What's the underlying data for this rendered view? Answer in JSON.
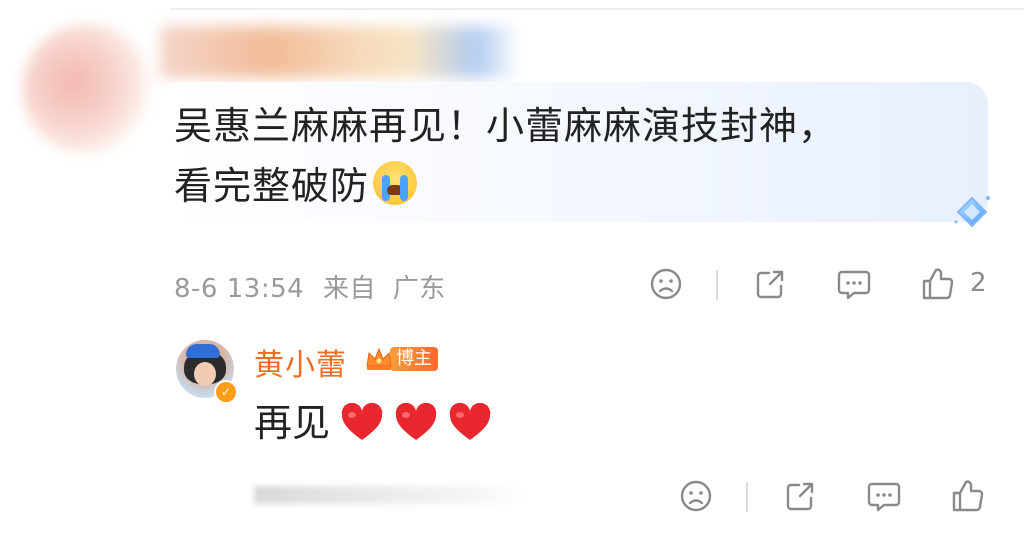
{
  "comment": {
    "text_line1": "吴惠兰麻麻再见！小蕾麻麻演技封神，",
    "text_line2": "看完整破防",
    "emoji": "loudly-crying-face-icon",
    "timestamp": "8-6 13:54",
    "source_prefix": "来自",
    "location": "广东",
    "like_count": "2"
  },
  "reply": {
    "author_name": "黄小蕾",
    "author_badge_label": "博主",
    "text": "再见",
    "emojis": [
      "red-heart-icon",
      "red-heart-icon",
      "red-heart-icon"
    ]
  },
  "colors": {
    "author_name": "#f26d22",
    "badge_orange": "#ff7a2c",
    "icon_gray": "#8a8a8a",
    "meta_gray": "#9a9a9a",
    "heart_red": "#e8262d",
    "bubble_blue": "#e8f0fe"
  },
  "icons": {
    "dislike": "sad-face-icon",
    "share": "share-icon",
    "reply": "comment-icon",
    "like": "thumbs-up-icon",
    "bubble_decoration": "diamond-sparkle-icon",
    "verified": "verified-check-icon",
    "badge": "crown-icon"
  }
}
